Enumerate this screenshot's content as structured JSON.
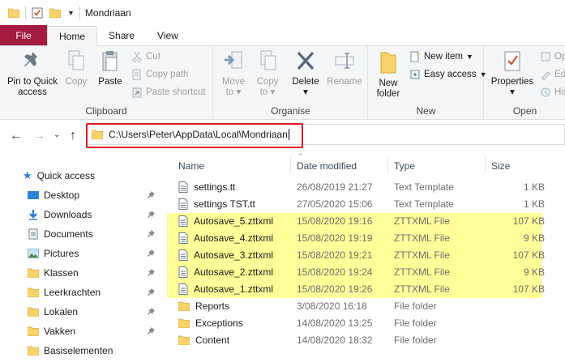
{
  "window": {
    "title": "Mondriaan"
  },
  "ribbon": {
    "tabs": [
      "File",
      "Home",
      "Share",
      "View"
    ],
    "clipboard": {
      "label": "Clipboard",
      "pin_line1": "Pin to Quick",
      "pin_line2": "access",
      "copy": "Copy",
      "paste": "Paste",
      "cut": "Cut",
      "copy_path": "Copy path",
      "paste_shortcut": "Paste shortcut"
    },
    "organise": {
      "label": "Organise",
      "move_to": "Move",
      "move_to_2": "to",
      "copy_to": "Copy",
      "copy_to_2": "to",
      "delete": "Delete",
      "rename": "Rename"
    },
    "new": {
      "label": "New",
      "new_folder_1": "New",
      "new_folder_2": "folder",
      "new_item": "New item",
      "easy_access": "Easy access"
    },
    "open": {
      "label": "Open",
      "properties": "Properties",
      "open": "Op",
      "edit": "Ed",
      "history": "His"
    }
  },
  "address": {
    "path": "C:\\Users\\Peter\\AppData\\Local\\Mondriaan"
  },
  "navpane": {
    "quick_access": "Quick access",
    "items": [
      "Desktop",
      "Downloads",
      "Documents",
      "Pictures",
      "Klassen",
      "Leerkrachten",
      "Lokalen",
      "Vakken",
      "Basiselementen"
    ]
  },
  "filelist": {
    "columns": {
      "name": "Name",
      "date": "Date modified",
      "type": "Type",
      "size": "Size"
    },
    "rows": [
      {
        "name": "settings.tt",
        "date": "26/08/2019 21:27",
        "type": "Text Template",
        "size": "1 KB",
        "kind": "file",
        "highlight": false
      },
      {
        "name": "settings TST.tt",
        "date": "27/05/2020 15:06",
        "type": "Text Template",
        "size": "1 KB",
        "kind": "file",
        "highlight": false
      },
      {
        "name": "Autosave_5.zttxml",
        "date": "15/08/2020 19:16",
        "type": "ZTTXML File",
        "size": "107 KB",
        "kind": "file",
        "highlight": true
      },
      {
        "name": "Autosave_4.zttxml",
        "date": "15/08/2020 19:19",
        "type": "ZTTXML File",
        "size": "9 KB",
        "kind": "file",
        "highlight": true
      },
      {
        "name": "Autosave_3.zttxml",
        "date": "15/08/2020 19:21",
        "type": "ZTTXML File",
        "size": "107 KB",
        "kind": "file",
        "highlight": true
      },
      {
        "name": "Autosave_2.zttxml",
        "date": "15/08/2020 19:24",
        "type": "ZTTXML File",
        "size": "9 KB",
        "kind": "file",
        "highlight": true
      },
      {
        "name": "Autosave_1.zttxml",
        "date": "15/08/2020 19:26",
        "type": "ZTTXML File",
        "size": "107 KB",
        "kind": "file",
        "highlight": true
      },
      {
        "name": "Reports",
        "date": "3/08/2020 16:18",
        "type": "File folder",
        "size": "",
        "kind": "folder",
        "highlight": false
      },
      {
        "name": "Exceptions",
        "date": "14/08/2020 13:25",
        "type": "File folder",
        "size": "",
        "kind": "folder",
        "highlight": false
      },
      {
        "name": "Content",
        "date": "14/08/2020 18:32",
        "type": "File folder",
        "size": "",
        "kind": "folder",
        "highlight": false
      }
    ]
  },
  "colors": {
    "file_tab": "#a31b3d",
    "highlight_row": "#ffff99",
    "address_callout": "#e01b24",
    "folder": "#f7d36a"
  }
}
